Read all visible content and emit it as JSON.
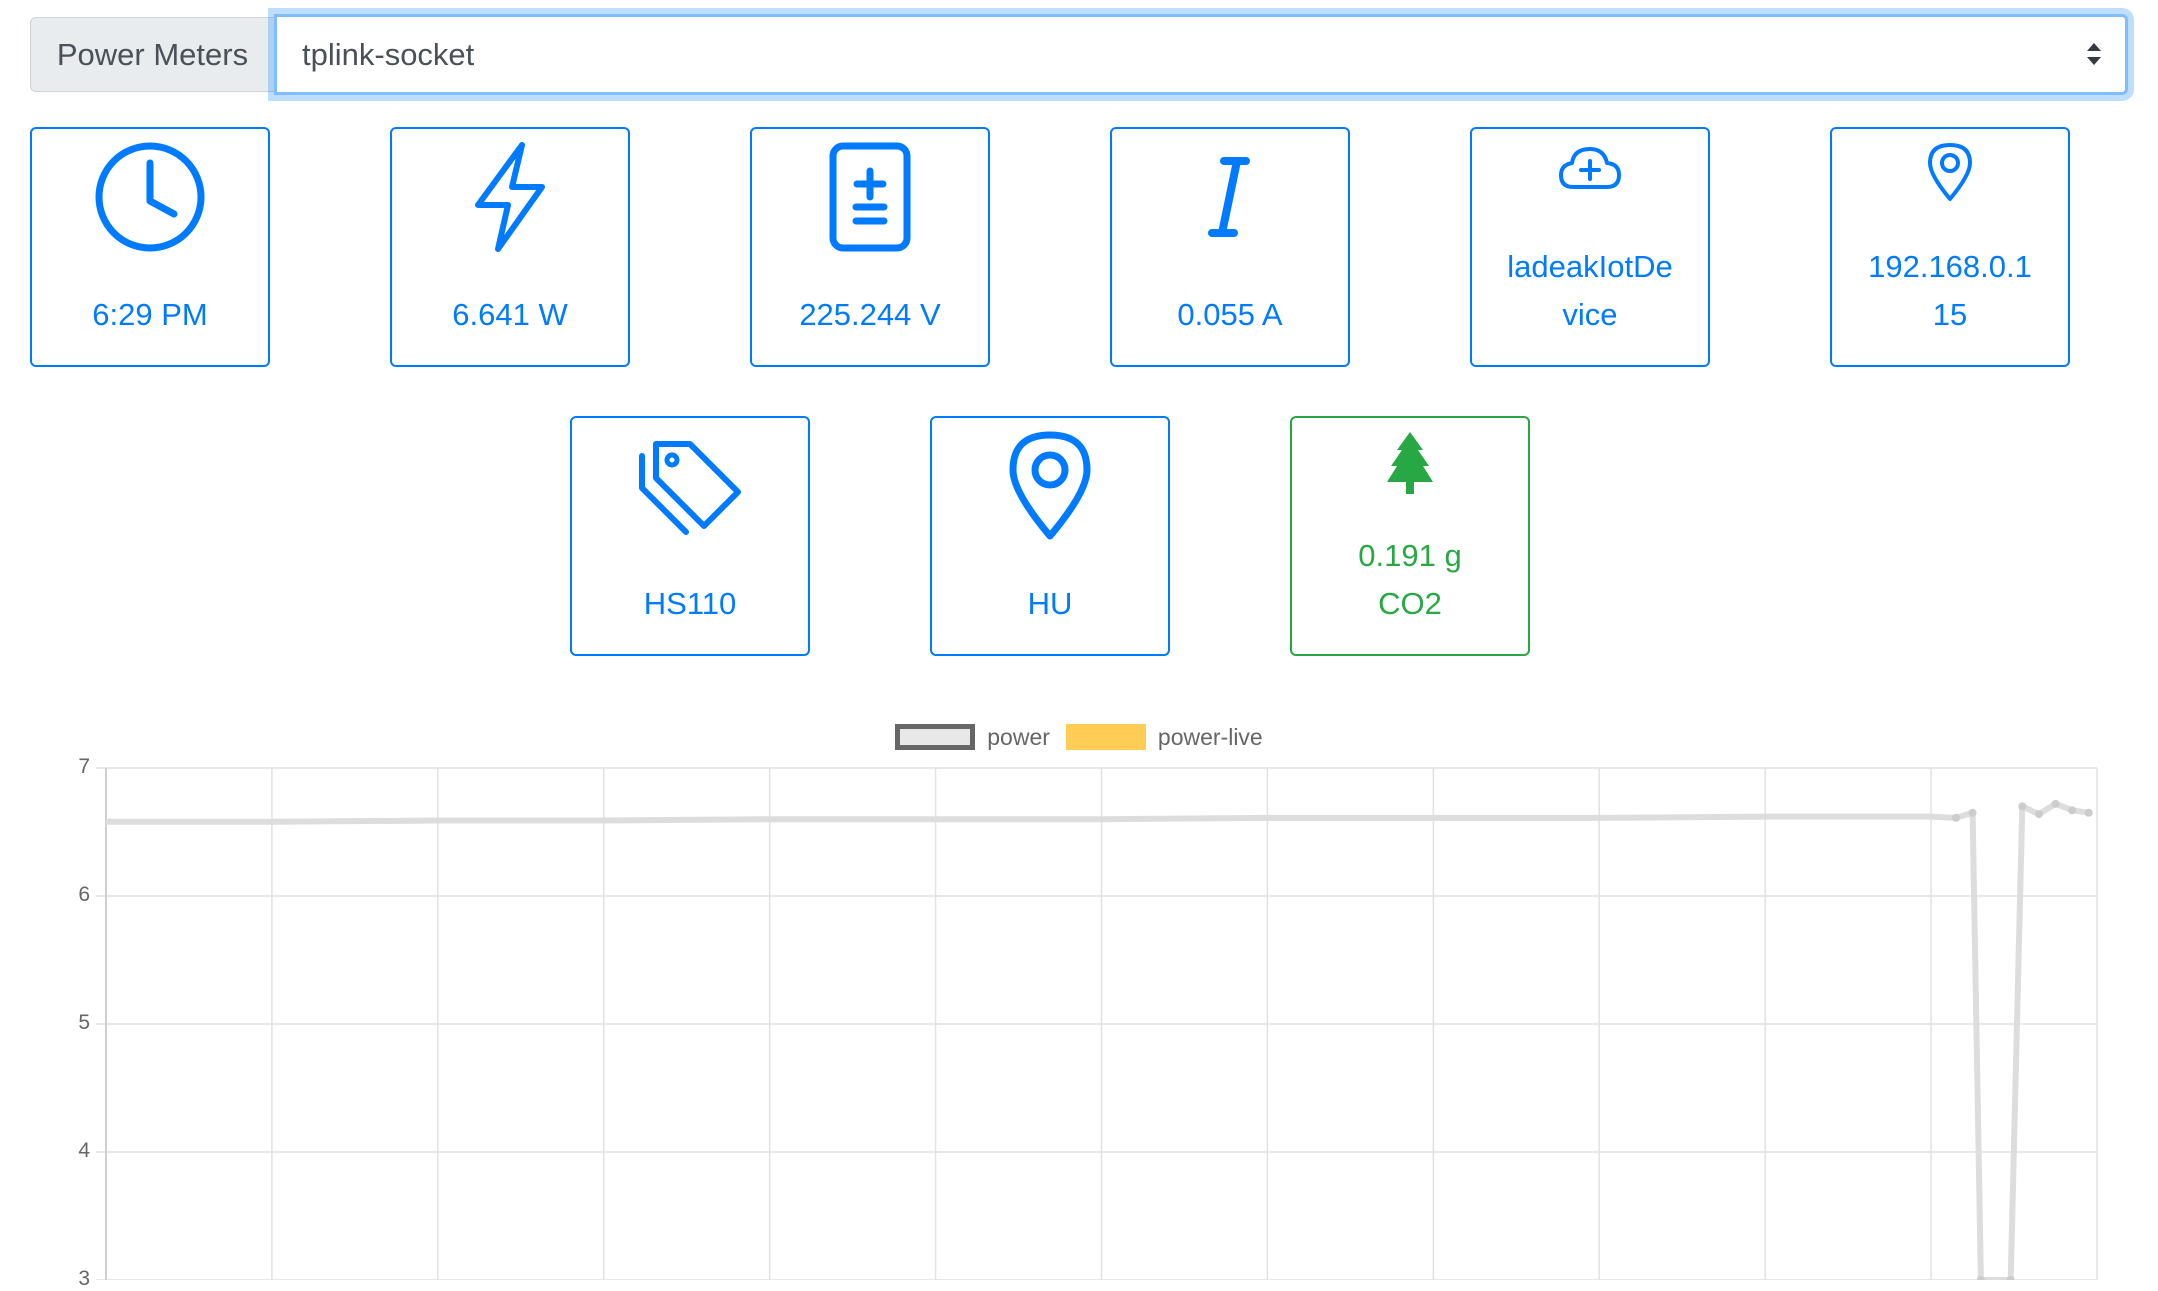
{
  "selector": {
    "label": "Power Meters",
    "selected": "tplink-socket"
  },
  "metrics": [
    {
      "icon": "clock-icon",
      "value_lines": [
        "6:29 PM"
      ]
    },
    {
      "icon": "lightning-icon",
      "value_lines": [
        "6.641 W"
      ]
    },
    {
      "icon": "voltage-plus-minus-icon",
      "value_lines": [
        "225.244 V"
      ]
    },
    {
      "icon": "current-italic-i-icon",
      "value_lines": [
        "0.055 A"
      ]
    },
    {
      "icon": "cloud-plus-icon",
      "value_lines": [
        "ladeakIotDe",
        "vice"
      ]
    },
    {
      "icon": "location-pin-icon",
      "value_lines": [
        "192.168.0.1",
        "15"
      ]
    },
    {
      "icon": "tags-icon",
      "value_lines": [
        "HS110"
      ]
    },
    {
      "icon": "map-marker-icon",
      "value_lines": [
        "HU"
      ]
    },
    {
      "icon": "tree-icon",
      "value_lines": [
        "0.191 g",
        "CO2"
      ]
    }
  ],
  "colors": {
    "primary": "#007bff",
    "success": "#28a745",
    "power_series": "#dddddd",
    "power_live_series": "#ffcd56"
  },
  "chart_data": {
    "type": "line",
    "legend_position": "top",
    "grid": true,
    "ylim": [
      3,
      7
    ],
    "yticks": [
      7,
      6,
      5,
      4,
      3
    ],
    "series": [
      {
        "name": "power",
        "color": "#dddddd",
        "points": [
          [
            0,
            6.58
          ],
          [
            1,
            6.58
          ],
          [
            2,
            6.59
          ],
          [
            3,
            6.59
          ],
          [
            4,
            6.6
          ],
          [
            5,
            6.6
          ],
          [
            6,
            6.6
          ],
          [
            7,
            6.61
          ],
          [
            8,
            6.61
          ],
          [
            9,
            6.61
          ],
          [
            10,
            6.62
          ],
          [
            11,
            6.62
          ],
          [
            11.15,
            6.61
          ],
          [
            11.25,
            6.65
          ],
          [
            11.3,
            3.0
          ],
          [
            11.48,
            3.0
          ],
          [
            11.55,
            6.7
          ],
          [
            11.65,
            6.64
          ],
          [
            11.75,
            6.72
          ],
          [
            11.85,
            6.67
          ],
          [
            11.95,
            6.65
          ]
        ]
      },
      {
        "name": "power-live",
        "color": "#ffcd56",
        "points": []
      }
    ]
  }
}
